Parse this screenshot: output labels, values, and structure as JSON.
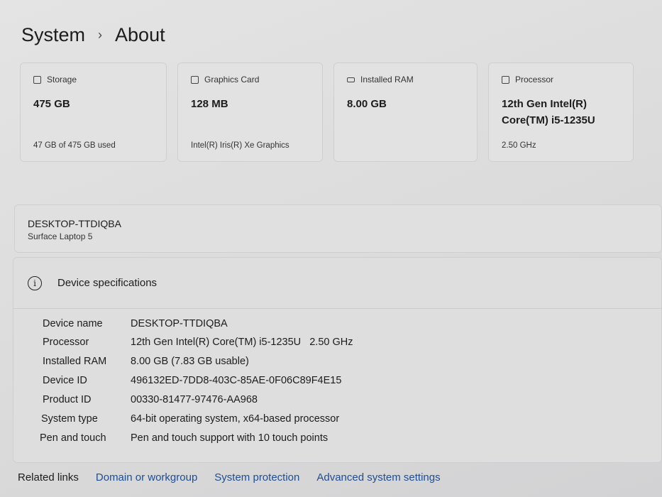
{
  "breadcrumb": {
    "parent": "System",
    "current": "About"
  },
  "cards": [
    {
      "label": "Storage",
      "value": "475 GB",
      "sub": "47 GB of 475 GB used"
    },
    {
      "label": "Graphics Card",
      "value": "128 MB",
      "sub": "Intel(R) Iris(R) Xe Graphics"
    },
    {
      "label": "Installed RAM",
      "value": "8.00 GB",
      "sub": ""
    },
    {
      "label": "Processor",
      "value": "12th Gen Intel(R) Core(TM) i5-1235U",
      "sub": "2.50 GHz"
    }
  ],
  "device": {
    "name": "DESKTOP-TTDIQBA",
    "model": "Surface Laptop 5"
  },
  "specs": {
    "title": "Device specifications",
    "rows": [
      {
        "k": "Device name",
        "v": "DESKTOP-TTDIQBA"
      },
      {
        "k": "Processor",
        "v": "12th Gen Intel(R) Core(TM) i5-1235U   2.50 GHz"
      },
      {
        "k": "Installed RAM",
        "v": "8.00 GB (7.83 GB usable)"
      },
      {
        "k": "Device ID",
        "v": "496132ED-7DD8-403C-85AE-0F06C89F4E15"
      },
      {
        "k": "Product ID",
        "v": "00330-81477-97476-AA968"
      },
      {
        "k": "System type",
        "v": "64-bit operating system, x64-based processor"
      },
      {
        "k": "Pen and touch",
        "v": "Pen and touch support with 10 touch points"
      }
    ]
  },
  "related": {
    "label": "Related links",
    "links": [
      "Domain or workgroup",
      "System protection",
      "Advanced system settings"
    ]
  }
}
